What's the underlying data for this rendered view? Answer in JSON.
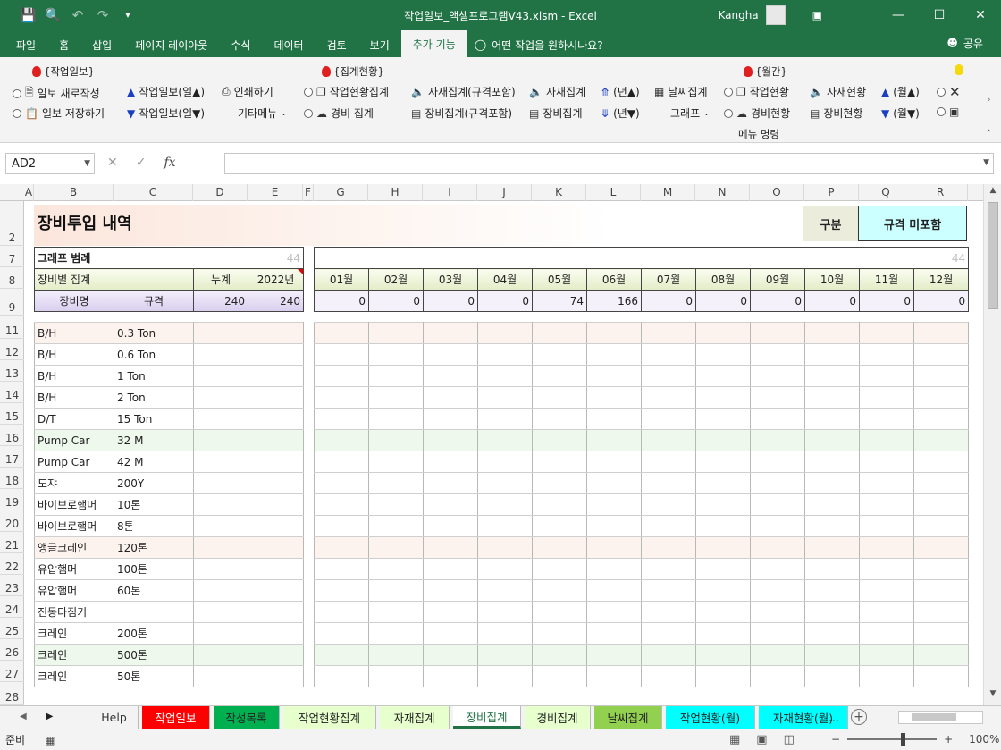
{
  "window": {
    "title": "작업일보_액셀프로그램V43.xlsm  -  Excel",
    "user": "Kangha",
    "qat_icons": [
      "save-icon",
      "print-preview-icon",
      "undo-icon",
      "redo-icon",
      "customize-icon"
    ]
  },
  "ribbon_tabs": [
    "파일",
    "홈",
    "삽입",
    "페이지 레이아웃",
    "수식",
    "데이터",
    "검토",
    "보기",
    "추가 기능"
  ],
  "active_ribbon_tab": "추가 기능",
  "tell_me": "어떤 작업을 원하시나요?",
  "share": "공유",
  "ribbon": {
    "g1_title": "{작업일보}",
    "g1_new": "일보 새로작성",
    "g1_save": "일보 저장하기",
    "g1_up": "작업일보(일▲)",
    "g1_down": "작업일보(일▼)",
    "g1_print": "인쇄하기",
    "g1_etc": "기타메뉴",
    "g2_title": "{집계현황}",
    "g2_work": "작업현황집계",
    "g2_cost": "경비 집계",
    "g2_mat_spec": "자재집계(규격포함)",
    "g2_eq_spec": "장비집계(규격포함)",
    "g2_mat": "자재집계",
    "g2_eq": "장비집계",
    "g2_year_up": "(년▲)",
    "g2_year_down": "(년▼)",
    "g2_weather": "날씨집계",
    "g2_graph": "그래프",
    "g3_title": "{월간}",
    "g3_work": "작업현황",
    "g3_cost": "경비현황",
    "g3_mat": "자재현황",
    "g3_eq": "장비현황",
    "g3_up": "(월▲)",
    "g3_down": "(월▼)",
    "menu_cmd": "메뉴 명령"
  },
  "formula_bar": {
    "name_box": "AD2",
    "fx": "fx",
    "value": ""
  },
  "columns": [
    "A",
    "B",
    "C",
    "D",
    "E",
    "F",
    "G",
    "H",
    "I",
    "J",
    "K",
    "L",
    "M",
    "N",
    "O",
    "P",
    "Q",
    "R"
  ],
  "rows": [
    "2",
    "7",
    "8",
    "9",
    "11",
    "12",
    "13",
    "14",
    "15",
    "16",
    "17",
    "18",
    "19",
    "20",
    "21",
    "22",
    "23",
    "24",
    "25",
    "26",
    "27",
    "28"
  ],
  "sheet": {
    "title": "장비투입 내역",
    "gubun": "구분",
    "spec_toggle": "규격 미포함",
    "legend": "그래프 범례",
    "legend_num": "44",
    "right_num": "44",
    "group_label": "장비별 집계",
    "total_label": "누계",
    "year_label": "2022년",
    "name_col": "장비명",
    "spec_col": "규격",
    "total_value": "240",
    "year_value": "240",
    "months": [
      "01월",
      "02월",
      "03월",
      "04월",
      "05월",
      "06월",
      "07월",
      "08월",
      "09월",
      "10월",
      "11월",
      "12월"
    ],
    "month_values": [
      "0",
      "0",
      "0",
      "0",
      "74",
      "166",
      "0",
      "0",
      "0",
      "0",
      "0",
      "0"
    ],
    "items": [
      {
        "name": "B/H",
        "spec": "0.3 Ton"
      },
      {
        "name": "B/H",
        "spec": "0.6 Ton"
      },
      {
        "name": "B/H",
        "spec": "1 Ton"
      },
      {
        "name": "B/H",
        "spec": "2 Ton"
      },
      {
        "name": "D/T",
        "spec": "15 Ton"
      },
      {
        "name": "Pump Car",
        "spec": "32 M"
      },
      {
        "name": "Pump Car",
        "spec": "42 M"
      },
      {
        "name": "도쟈",
        "spec": "200Y"
      },
      {
        "name": "바이브로햄머",
        "spec": "10톤"
      },
      {
        "name": "바이브로햄머",
        "spec": "8톤"
      },
      {
        "name": "앵글크레인",
        "spec": "120톤"
      },
      {
        "name": "유압햄머",
        "spec": "100톤"
      },
      {
        "name": "유압햄머",
        "spec": "60톤"
      },
      {
        "name": "진동다짐기",
        "spec": ""
      },
      {
        "name": "크레인",
        "spec": "200톤"
      },
      {
        "name": "크레인",
        "spec": "500톤"
      },
      {
        "name": "크레인",
        "spec": "50톤"
      }
    ]
  },
  "sheet_tabs": [
    {
      "label": "Help",
      "color": "#f3f3f3",
      "fg": "#333333"
    },
    {
      "label": "작업일보",
      "color": "#ff0000",
      "fg": "#ffffff"
    },
    {
      "label": "작성목록",
      "color": "#00b050",
      "fg": "#222222"
    },
    {
      "label": "작업현황집계",
      "color": "#e6ffcc",
      "fg": "#222222"
    },
    {
      "label": "자재집계",
      "color": "#e6ffcc",
      "fg": "#222222"
    },
    {
      "label": "장비집계",
      "color": "#ffffff",
      "fg": "#217346"
    },
    {
      "label": "경비집계",
      "color": "#e6ffcc",
      "fg": "#222222"
    },
    {
      "label": "날씨집계",
      "color": "#92d050",
      "fg": "#222222"
    },
    {
      "label": "작업현황(월)",
      "color": "#00ffff",
      "fg": "#222222"
    },
    {
      "label": "자재현황(월)",
      "color": "#00ffff",
      "fg": "#222222"
    }
  ],
  "tabs_more": "...",
  "status": {
    "ready": "준비",
    "zoom": "100%"
  },
  "colors": {
    "excel_green": "#217346",
    "banner_pink": "#fbe6dc",
    "spec_cyan": "#ccffff"
  }
}
